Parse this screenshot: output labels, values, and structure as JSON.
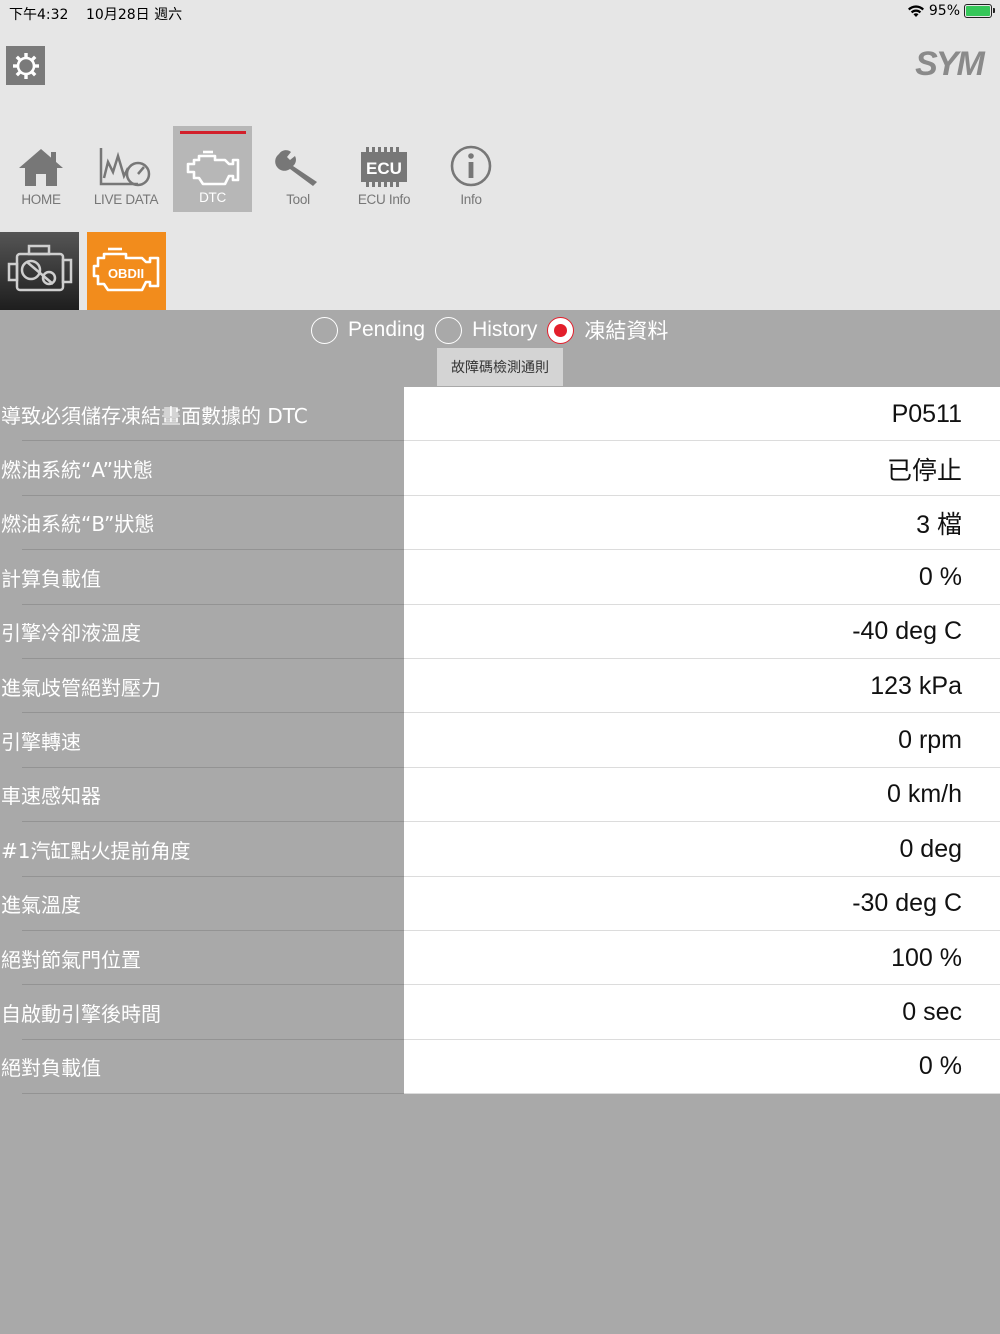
{
  "status_bar": {
    "time": "下午4:32",
    "date": "10月28日 週六",
    "battery": "95%"
  },
  "brand": {
    "logo_text": "SYM"
  },
  "tabs": [
    {
      "label": "HOME",
      "icon": "home-icon"
    },
    {
      "label": "LIVE DATA",
      "icon": "live-data-icon"
    },
    {
      "label": "DTC",
      "icon": "engine-icon",
      "active": true
    },
    {
      "label": "Tool",
      "icon": "wrench-icon"
    },
    {
      "label": "ECU Info",
      "icon": "ecu-chip-icon"
    },
    {
      "label": "Info",
      "icon": "info-icon"
    }
  ],
  "subtabs": {
    "obd_label": "OBDII"
  },
  "radio_options": [
    {
      "label": "Pending",
      "selected": false
    },
    {
      "label": "History",
      "selected": false
    },
    {
      "label": "凍結資料",
      "selected": true
    }
  ],
  "rule_button": "故障碼檢測通則",
  "rows": [
    {
      "label": "導致必須儲存凍結畫面數據的 DTC",
      "value": "P0511"
    },
    {
      "label": "燃油系統“A”狀態",
      "value": "已停止"
    },
    {
      "label": "燃油系統“B”狀態",
      "value": "3 檔"
    },
    {
      "label": "計算負載值",
      "value": "0 %"
    },
    {
      "label": "引擎冷卻液溫度",
      "value": "-40 deg C"
    },
    {
      "label": "進氣歧管絕對壓力",
      "value": "123 kPa"
    },
    {
      "label": "引擎轉速",
      "value": "0 rpm"
    },
    {
      "label": "車速感知器",
      "value": "0 km/h"
    },
    {
      "label": "#1汽缸點火提前角度",
      "value": "0 deg"
    },
    {
      "label": "進氣溫度",
      "value": "-30 deg C"
    },
    {
      "label": "絕對節氣門位置",
      "value": "100 %"
    },
    {
      "label": "自啟動引擎後時間",
      "value": "0 sec"
    },
    {
      "label": "絕對負載值",
      "value": "0 %"
    }
  ],
  "colors": {
    "accent_red": "#e31e2b",
    "obd_orange": "#f28c1c",
    "background_gray": "#a9a9a9"
  }
}
